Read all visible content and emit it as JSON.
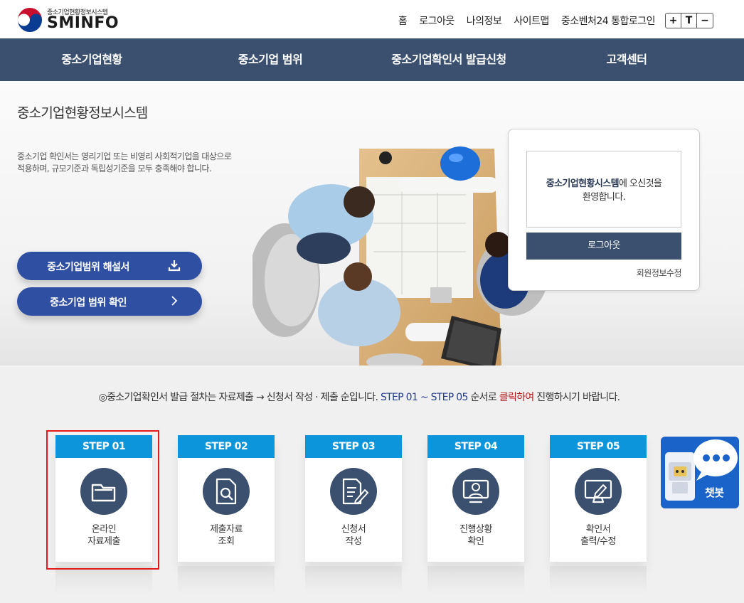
{
  "header": {
    "logo_sub": "중소기업현황정보시스템",
    "logo_main": "SMINFO",
    "util_links": [
      "홈",
      "로그아웃",
      "나의정보",
      "사이트맵",
      "중소벤처24 통합로그인"
    ],
    "font_controls": [
      "+",
      "T",
      "−"
    ]
  },
  "nav": {
    "items": [
      "중소기업현황",
      "중소기업 범위",
      "중소기업확인서 발급신청",
      "고객센터"
    ]
  },
  "hero": {
    "title": "중소기업현황정보시스템",
    "description": "중소기업 확인서는 영리기업 또는 비영리 사회적기업을 대상으로 적용하며, 규모기준과 독립성기준을 모두 충족해야 합니다.",
    "btn_guide": "중소기업범위 해설서",
    "btn_check": "중소기업 범위 확인"
  },
  "login": {
    "welcome_bold": "중소기업현황시스템",
    "welcome_rest": "에 오신것을",
    "welcome_line2": "환영합니다.",
    "logout_label": "로그아웃",
    "modify_label": "회원정보수정"
  },
  "notice": {
    "part1": "◎중소기업확인서 발급 절차는 자료제출 → 신청서 작성 · 제출 순입니다.",
    "part2": "STEP 01 ~ STEP 05",
    "part3": "순서로",
    "part4": "클릭하여",
    "part5": "진행하시기 바랍니다."
  },
  "steps": [
    {
      "step": "STEP 01",
      "line1": "온라인",
      "line2": "자료제출",
      "icon": "folder-icon"
    },
    {
      "step": "STEP 02",
      "line1": "제출자료",
      "line2": "조회",
      "icon": "document-search-icon"
    },
    {
      "step": "STEP 03",
      "line1": "신청서",
      "line2": "작성",
      "icon": "document-edit-icon"
    },
    {
      "step": "STEP 04",
      "line1": "진행상황",
      "line2": "확인",
      "icon": "person-monitor-icon"
    },
    {
      "step": "STEP 05",
      "line1": "확인서",
      "line2": "출력/수정",
      "icon": "monitor-edit-icon"
    }
  ],
  "chatbot": {
    "label": "챗봇"
  },
  "colors": {
    "nav_bg": "#3b506e",
    "step_header": "#0d95dc",
    "hero_button": "#2f4fa3",
    "chatbot": "#1a63c9",
    "highlight": "#e31a1a"
  }
}
